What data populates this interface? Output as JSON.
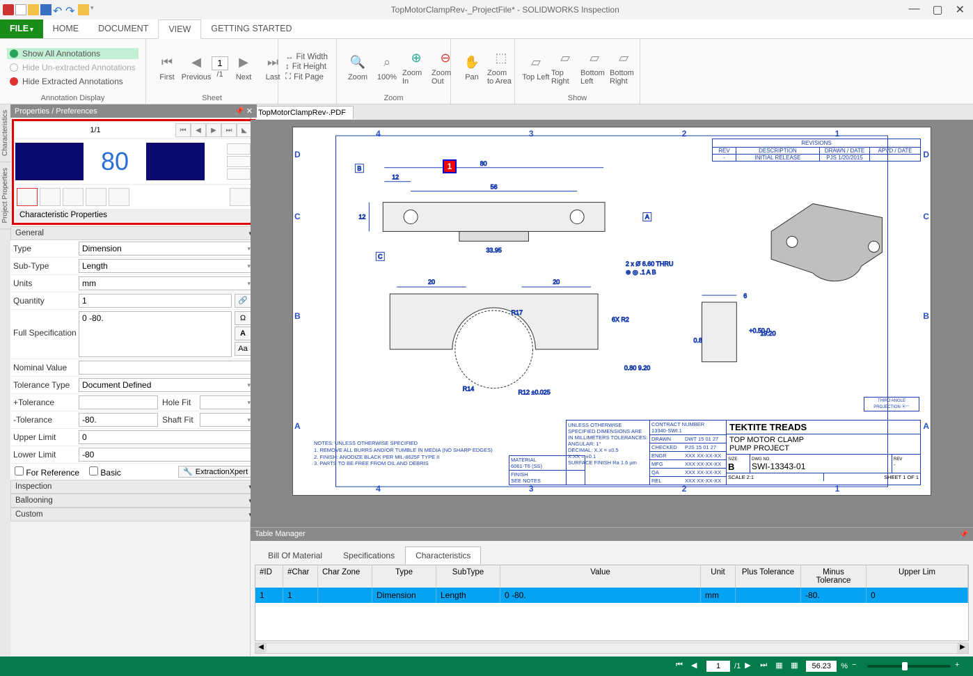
{
  "titlebar": {
    "title": "TopMotorClampRev-_ProjectFile* - SOLIDWORKS Inspection"
  },
  "menu": {
    "file": "FILE",
    "home": "HOME",
    "document": "DOCUMENT",
    "view": "VIEW",
    "start": "GETTING STARTED"
  },
  "ribbon": {
    "anno": {
      "show": "Show All Annotations",
      "hideun": "Hide Un-extracted Annotations",
      "hideex": "Hide Extracted Annotations",
      "group": "Annotation Display"
    },
    "sheet": {
      "first": "First",
      "prev": "Previous",
      "pages": "/1",
      "pagenum": "1",
      "next": "Next",
      "last": "Last",
      "group": "Sheet"
    },
    "fit": {
      "width": "Fit Width",
      "height": "Fit Height",
      "page": "Fit Page"
    },
    "zoom": {
      "zoom": "Zoom",
      "z100": "100%",
      "zin": "Zoom In",
      "zout": "Zoom Out",
      "group": "Zoom"
    },
    "pan": {
      "pan": "Pan",
      "area": "Zoom to Area"
    },
    "show": {
      "tl": "Top Left",
      "tr": "Top Right",
      "bl": "Bottom Left",
      "br": "Bottom Right",
      "group": "Show"
    }
  },
  "leftpanel": {
    "hdr": "Properties / Preferences",
    "sidetabs": {
      "t1": "Characteristics",
      "t2": "Project Properties"
    },
    "page": "1/1",
    "eighty": "80",
    "charprops": "Characteristic Properties",
    "general": "General",
    "rows": {
      "type_l": "Type",
      "type_v": "Dimension",
      "subtype_l": "Sub-Type",
      "subtype_v": "Length",
      "units_l": "Units",
      "units_v": "mm",
      "qty_l": "Quantity",
      "qty_v": "1",
      "fullspec_l": "Full Specification",
      "fullspec_v": "0 -80.",
      "nom_l": "Nominal Value",
      "nom_v": "",
      "toltype_l": "Tolerance Type",
      "toltype_v": "Document Defined",
      "ptol_l": "+Tolerance",
      "ptol_v": "",
      "holefit_l": "Hole Fit",
      "holefit_v": "",
      "mtol_l": "-Tolerance",
      "mtol_v": "-80.",
      "shaftfit_l": "Shaft Fit",
      "shaftfit_v": "",
      "ul_l": "Upper Limit",
      "ul_v": "0",
      "ll_l": "Lower Limit",
      "ll_v": "-80",
      "forref": "For Reference",
      "basic": "Basic",
      "xpert": "ExtractionXpert"
    },
    "sections": {
      "insp": "Inspection",
      "ball": "Ballooning",
      "cust": "Custom"
    }
  },
  "doctab": "TopMotorClampRev-.PDF",
  "drawing": {
    "balloon1": "1",
    "zonesTop": [
      "4",
      "3",
      "2",
      "1"
    ],
    "zonesBot": [
      "4",
      "3",
      "2",
      "1"
    ],
    "zonesLeft": [
      "D",
      "C",
      "B",
      "A"
    ],
    "zonesRight": [
      "D",
      "C",
      "B",
      "A"
    ],
    "revhdr": "REVISIONS",
    "revcols": {
      "rev": "REV",
      "desc": "DESCRIPTION",
      "drawn": "DRAWN / DATE",
      "apvd": "APVD / DATE"
    },
    "revrow": {
      "rev": "-",
      "desc": "INITIAL RELEASE",
      "drawn": "PJS 1/20/2015",
      "apvd": ""
    },
    "dims": {
      "d80": "80",
      "d12": "12",
      "d56": "56",
      "d3395": "33.95",
      "d20a": "20",
      "d20b": "20",
      "dR17": "R17",
      "dR14": "R14",
      "dR12": "R12 ±0.025",
      "d6xR2": "6X R2",
      "d6": "6",
      "d050": "+0.50 0",
      "d1920": "19.20",
      "d080": "0.80",
      "d920": "9.20",
      "d08b": "0.8",
      "dholes": "2 x Ø 6.60 THRU",
      "gdt": "⊕ ◎ .1 A B"
    },
    "tp": {
      "proj": "THIRD ANGLE PROJECTION"
    },
    "tb": {
      "company": "TEKTITE TREADS",
      "title1": "TOP MOTOR CLAMP",
      "title2": "PUMP PROJECT",
      "sizeL": "SIZE",
      "size": "B",
      "dwgL": "DWG NO.",
      "dwg": "SWI-13343-01",
      "revL": "REV",
      "rev": "-",
      "scale": "SCALE 2:1",
      "sheet": "SHEET 1 OF 1",
      "contractL": "CONTRACT NUMBER",
      "contract": "13340-SWI.1",
      "drawnL": "DRAWN",
      "drawnV": "DWT 15 01 27",
      "checkedL": "CHECKED",
      "checkedV": "PJS 15 01 27",
      "engrL": "ENGR",
      "engrV": "XXX XX-XX-XX",
      "mfgL": "MFG",
      "mfgV": "XXX XX-XX-XX",
      "qaL": "QA",
      "qaV": "XXX XX-XX-XX",
      "relL": "REL",
      "relV": "XXX XX-XX-XX",
      "matL": "MATERIAL",
      "matV": "6061-T6 (SS)",
      "finL": "FINISH",
      "finV": "SEE NOTES",
      "tolhdr": "UNLESS OTHERWISE SPECIFIED DIMENSIONS ARE IN MILLIMETERS TOLERANCES:",
      "tol1": "ANGULAR: 1°",
      "tol2": "DECIMAL:  X.X   = ±0.5",
      "tol3": "X.XX = ±0.1",
      "tol4": "SURFACE FINISH Ra 1.6 µm"
    },
    "notes": {
      "h": "NOTES:  UNLESS OTHERWISE SPECIFIED",
      "n1": "1. REMOVE ALL BURRS AND/OR TUMBLE IN MEDIA (NO SHARP EDGES)",
      "n2": "2. FINISH:  ANODIZE BLACK PER MIL-8625F TYPE II",
      "n3": "3. PARTS TO BE FREE FROM OIL AND DEBRIS"
    }
  },
  "tablemgr": {
    "hdr": "Table Manager",
    "tabs": {
      "bom": "Bill Of Material",
      "spec": "Specifications",
      "char": "Characteristics"
    },
    "cols": {
      "id": "#ID",
      "char": "#Char",
      "zone": "Char Zone",
      "type": "Type",
      "sub": "SubType",
      "val": "Value",
      "unit": "Unit",
      "ptol": "Plus Tolerance",
      "mtol": "Minus Tolerance",
      "ul": "Upper Lim"
    },
    "row": {
      "id": "1",
      "char": "1",
      "zone": "",
      "type": "Dimension",
      "sub": "Length",
      "val": "0 -80.",
      "unit": "mm",
      "ptol": "",
      "mtol": "-80.",
      "ul": "0"
    }
  },
  "status": {
    "page": "1",
    "pages": "/1",
    "zoom": "56.23",
    "pct": "%"
  }
}
